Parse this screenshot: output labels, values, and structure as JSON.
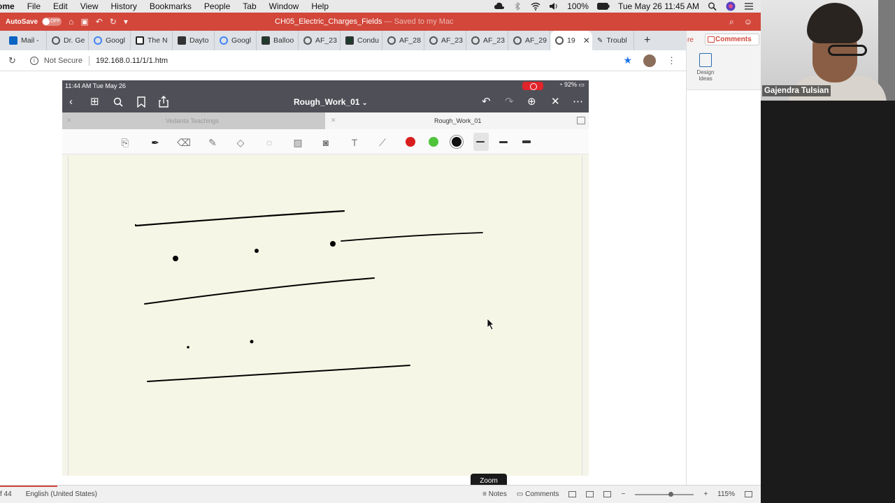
{
  "menubar": {
    "app": "ome",
    "items": [
      "File",
      "Edit",
      "View",
      "History",
      "Bookmarks",
      "People",
      "Tab",
      "Window",
      "Help"
    ],
    "battery": "100%",
    "datetime": "Tue May 26  11:45 AM"
  },
  "word": {
    "autosave_label": "AutoSave",
    "autosave_state": "OFF",
    "doc_title": "CH05_Electric_Charges_Fields",
    "saved_status": " — Saved to my Mac",
    "ribbon_partial": "re",
    "comments_label": "Comments",
    "design_ideas": "Design Ideas",
    "status_page": "f 44",
    "status_language": "English (United States)",
    "status_notes": "Notes",
    "status_comments": "Comments",
    "zoom_level": "115%"
  },
  "browser": {
    "tabs": [
      {
        "label": "Mail -",
        "icon": "outlook-icon"
      },
      {
        "label": "Dr. Ge",
        "icon": "globe-icon"
      },
      {
        "label": "Googl",
        "icon": "google-icon"
      },
      {
        "label": "The N",
        "icon": "nyt-icon"
      },
      {
        "label": "Dayto",
        "icon": "nj-icon"
      },
      {
        "label": "Googl",
        "icon": "google-icon"
      },
      {
        "label": "Balloo",
        "icon": "phet-icon"
      },
      {
        "label": "AF_23",
        "icon": "globe-icon"
      },
      {
        "label": "Condu",
        "icon": "phet-icon"
      },
      {
        "label": "AF_28",
        "icon": "globe-icon"
      },
      {
        "label": "AF_23",
        "icon": "globe-icon"
      },
      {
        "label": "AF_23",
        "icon": "globe-icon"
      },
      {
        "label": "AF_29",
        "icon": "globe-icon"
      },
      {
        "label": "19",
        "icon": "globe-icon",
        "active": true
      },
      {
        "label": "Troubl",
        "icon": "pen-icon"
      }
    ],
    "security": "Not Secure",
    "url": "192.168.0.11/1/1.htm"
  },
  "ipad": {
    "time": "11:44 AM   Tue May 26",
    "battery": "92%",
    "notebook_title": "Rough_Work_01",
    "tab_inactive": "Vedanta Teachings",
    "tab_active": "Rough_Work_01",
    "colors": [
      "#d81e1e",
      "#4fc43a",
      "#111111"
    ],
    "zoom_tooltip": "Zoom"
  },
  "video": {
    "participant_name": "Gajendra Tulsian"
  }
}
